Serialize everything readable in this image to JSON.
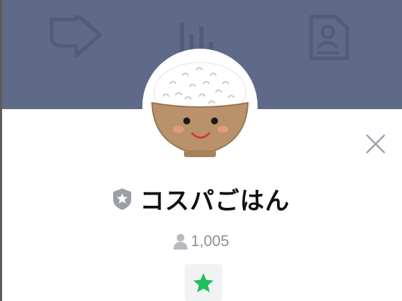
{
  "profile": {
    "name": "コスパごはん",
    "friends_count": "1,005",
    "avatar": "rice-bowl-character"
  },
  "header": {
    "icons": [
      "share-arrow-icon",
      "stats-bars-icon",
      "profile-document-icon"
    ]
  },
  "icons": {
    "badge": "shield-star-icon",
    "friends": "person-icon",
    "favorite": "star-icon",
    "close": "close-icon"
  },
  "colors": {
    "header_background": "#5f6a88",
    "favorite_star": "#1fbf5b",
    "friends_text": "#8a8f99",
    "badge": "#9aa0aa"
  }
}
